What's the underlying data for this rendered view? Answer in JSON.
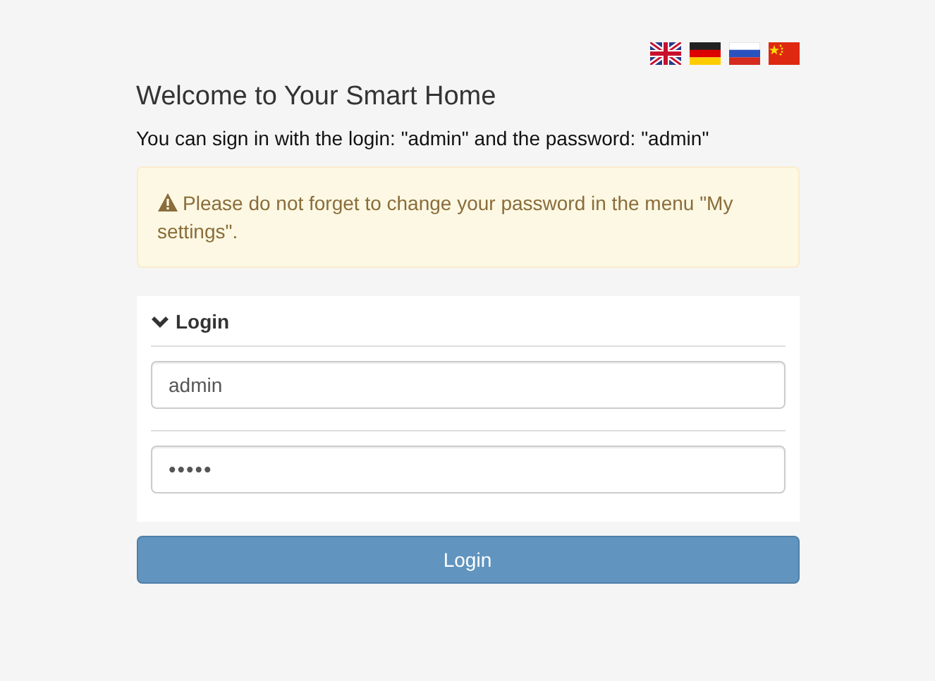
{
  "title": "Welcome to Your Smart Home",
  "hint": "You can sign in with the login: \"admin\" and the password: \"admin\"",
  "warning": "Please do not forget to change your password in the menu \"My settings\".",
  "login_panel": {
    "title": "Login",
    "expanded": true,
    "username": {
      "value": "admin"
    },
    "password": {
      "value": "•••••"
    }
  },
  "button": "Login"
}
